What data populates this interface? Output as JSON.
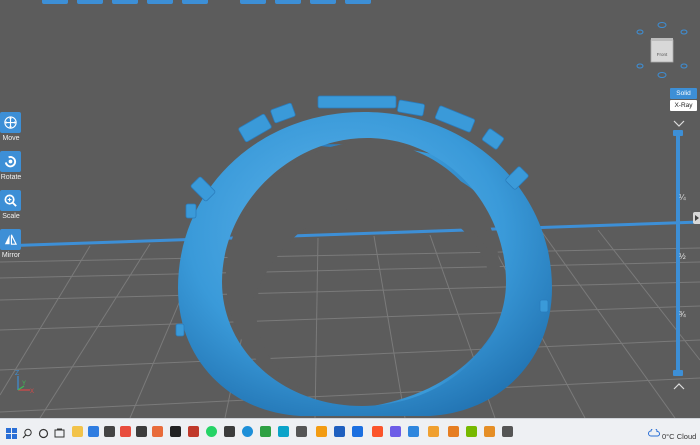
{
  "tools": [
    {
      "label": "Move",
      "icon": "move-icon"
    },
    {
      "label": "Rotate",
      "icon": "rotate-icon"
    },
    {
      "label": "Scale",
      "icon": "scale-icon"
    },
    {
      "label": "Mirror",
      "icon": "mirror-icon"
    }
  ],
  "view_modes": {
    "solid": "Solid",
    "xray": "X-Ray"
  },
  "view_cube": {
    "face_label": "Front"
  },
  "layer_slider": {
    "labels": [
      "¼",
      "½",
      "¾"
    ],
    "top_icon": "chevron-down-icon",
    "bottom_icon": "chevron-up-icon"
  },
  "axes": {
    "z": "Z",
    "y": "Y",
    "x": "X"
  },
  "taskbar": {
    "icons": [
      "windows-start-icon",
      "search-icon",
      "cortana-icon",
      "task-view-icon",
      "file-explorer-icon",
      "app-icon",
      "app-icon",
      "app-icon",
      "app-icon",
      "app-icon",
      "whatsapp-icon",
      "app-icon",
      "edge-icon",
      "app-icon",
      "app-icon",
      "app-icon",
      "app-icon",
      "app-icon",
      "app-icon",
      "brave-icon",
      "app-icon",
      "app-icon",
      "app-icon",
      "nvidia-icon",
      "app-icon",
      "app-icon"
    ],
    "weather": {
      "temp": "0°C",
      "condition": "Cloud"
    }
  },
  "colors": {
    "accent": "#3d8fd6",
    "model": "#3a9ad9",
    "background": "#5c5c5c",
    "grid": "#7a7a7a"
  }
}
